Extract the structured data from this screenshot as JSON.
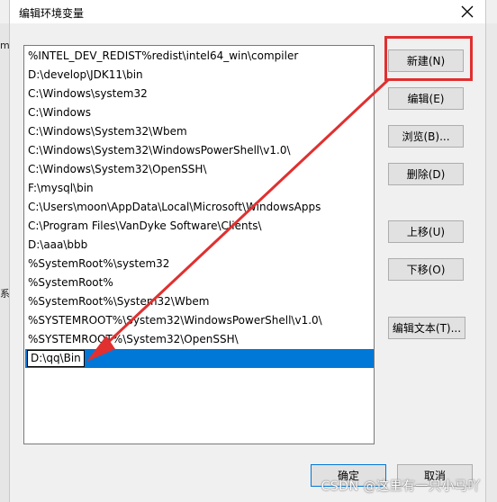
{
  "dialog": {
    "title": "编辑环境变量",
    "paths": [
      "%INTEL_DEV_REDIST%redist\\intel64_win\\compiler",
      "D:\\develop\\JDK11\\bin",
      "C:\\Windows\\system32",
      "C:\\Windows",
      "C:\\Windows\\System32\\Wbem",
      "C:\\Windows\\System32\\WindowsPowerShell\\v1.0\\",
      "C:\\Windows\\System32\\OpenSSH\\",
      "F:\\mysql\\bin",
      "C:\\Users\\moon\\AppData\\Local\\Microsoft\\WindowsApps",
      "C:\\Program Files\\VanDyke Software\\Clients\\",
      "D:\\aaa\\bbb",
      "%SystemRoot%\\system32",
      "%SystemRoot%",
      "%SystemRoot%\\System32\\Wbem",
      "%SYSTEMROOT%\\System32\\WindowsPowerShell\\v1.0\\",
      "%SYSTEMROOT%\\System32\\OpenSSH\\"
    ],
    "editing_value": "D:\\qq\\Bin",
    "buttons": {
      "new": "新建(N)",
      "edit": "编辑(E)",
      "browse": "浏览(B)...",
      "delete": "删除(D)",
      "move_up": "上移(U)",
      "move_down": "下移(O)",
      "edit_text": "编辑文本(T)...",
      "ok": "确定",
      "cancel": "取消"
    }
  },
  "background": {
    "left_labels": [
      "m",
      "系"
    ]
  },
  "watermark": "CSDN @这里有一只小马吖",
  "colors": {
    "selection": "#0078d7",
    "annotation_red": "#e03030"
  },
  "icons": [
    "close-icon"
  ]
}
